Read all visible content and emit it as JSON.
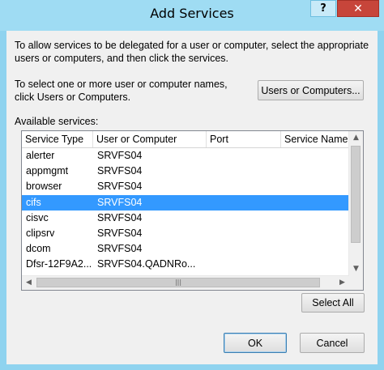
{
  "window": {
    "title": "Add Services",
    "help_label": "?",
    "close_label": "✕"
  },
  "intro_text": "To allow services to be delegated for a user or computer, select the appropriate users or computers, and then click the services.",
  "select_text": "To select one or more user or computer names, click Users or Computers.",
  "users_button_label": "Users or Computers...",
  "available_label": "Available services:",
  "list": {
    "columns": [
      "Service Type",
      "User or Computer",
      "Port",
      "Service Name"
    ],
    "rows": [
      {
        "type": "alerter",
        "user": "SRVFS04",
        "port": "",
        "name": ""
      },
      {
        "type": "appmgmt",
        "user": "SRVFS04",
        "port": "",
        "name": ""
      },
      {
        "type": "browser",
        "user": "SRVFS04",
        "port": "",
        "name": ""
      },
      {
        "type": "cifs",
        "user": "SRVFS04",
        "port": "",
        "name": ""
      },
      {
        "type": "cisvc",
        "user": "SRVFS04",
        "port": "",
        "name": ""
      },
      {
        "type": "clipsrv",
        "user": "SRVFS04",
        "port": "",
        "name": ""
      },
      {
        "type": "dcom",
        "user": "SRVFS04",
        "port": "",
        "name": ""
      },
      {
        "type": "Dfsr-12F9A2...",
        "user": "SRVFS04.QADNRo...",
        "port": "",
        "name": ""
      }
    ],
    "selected_index": 3
  },
  "select_all_label": "Select All",
  "ok_label": "OK",
  "cancel_label": "Cancel",
  "colors": {
    "title_bar": "#9fdcf3",
    "close_button": "#c7453a",
    "selection": "#3399ff"
  }
}
